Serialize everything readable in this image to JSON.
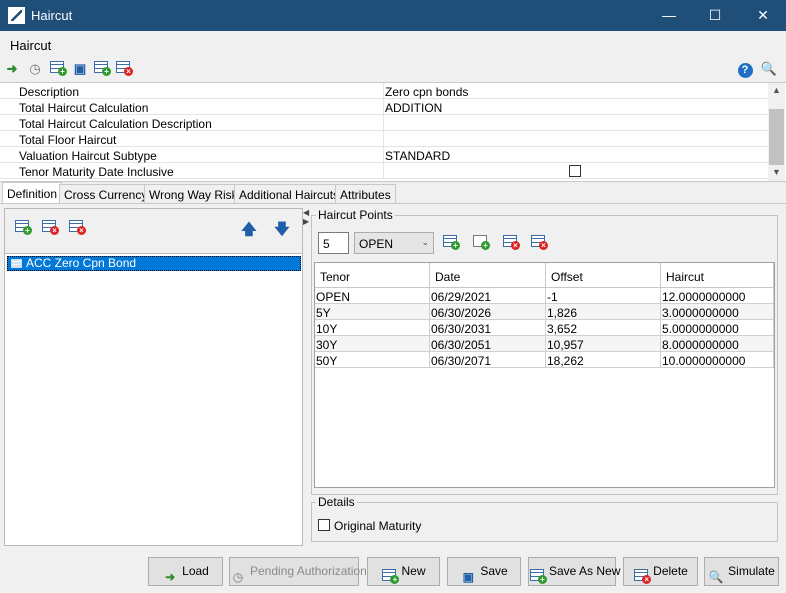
{
  "window": {
    "title": "Haircut",
    "minimize_icon": "minimize-icon",
    "maximize_icon": "maximize-icon",
    "close_icon": "close-icon"
  },
  "header": {
    "label": "Haircut"
  },
  "properties": [
    {
      "key": "Description",
      "value": "Zero cpn bonds"
    },
    {
      "key": "Total Haircut Calculation",
      "value": "ADDITION"
    },
    {
      "key": "Total Haircut Calculation Description",
      "value": ""
    },
    {
      "key": "Total Floor Haircut",
      "value": ""
    },
    {
      "key": "Valuation Haircut Subtype",
      "value": "STANDARD"
    },
    {
      "key": "Tenor Maturity Date Inclusive",
      "value": ""
    }
  ],
  "tabs": [
    "Definition",
    "Cross Currency",
    "Wrong Way Risk",
    "Additional Haircuts",
    "Attributes"
  ],
  "left_list": {
    "items": [
      "ACC Zero Cpn Bond"
    ]
  },
  "haircut_points": {
    "legend": "Haircut Points",
    "count": "5",
    "selected_tenor": "OPEN",
    "columns": [
      "Tenor",
      "Date",
      "Offset",
      "Haircut"
    ],
    "rows": [
      [
        "OPEN",
        "06/29/2021",
        "-1",
        "12.0000000000"
      ],
      [
        "5Y",
        "06/30/2026",
        "1,826",
        "3.0000000000"
      ],
      [
        "10Y",
        "06/30/2031",
        "3,652",
        "5.0000000000"
      ],
      [
        "30Y",
        "06/30/2051",
        "10,957",
        "8.0000000000"
      ],
      [
        "50Y",
        "06/30/2071",
        "18,262",
        "10.0000000000"
      ]
    ]
  },
  "details": {
    "legend": "Details",
    "original_maturity_label": "Original Maturity"
  },
  "buttons": {
    "load": "Load",
    "pending": "Pending Authorization",
    "new": "New",
    "save": "Save",
    "save_as_new": "Save As New",
    "delete": "Delete",
    "simulate": "Simulate"
  }
}
